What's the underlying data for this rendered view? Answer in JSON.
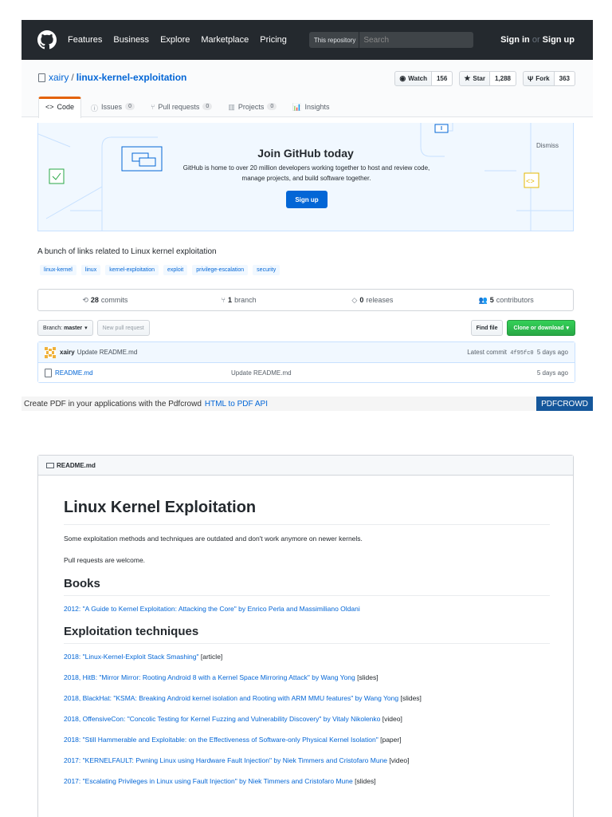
{
  "header": {
    "nav": [
      "Features",
      "Business",
      "Explore",
      "Marketplace",
      "Pricing"
    ],
    "search_scope": "This repository",
    "search_placeholder": "Search",
    "sign_in": "Sign in",
    "or": "or",
    "sign_up": "Sign up"
  },
  "repo": {
    "owner": "xairy",
    "name": "linux-kernel-exploitation",
    "watch_label": "Watch",
    "watch_count": "156",
    "star_label": "Star",
    "star_count": "1,288",
    "fork_label": "Fork",
    "fork_count": "363"
  },
  "tabs": [
    {
      "label": "Code",
      "counter": ""
    },
    {
      "label": "Issues",
      "counter": "0"
    },
    {
      "label": "Pull requests",
      "counter": "0"
    },
    {
      "label": "Projects",
      "counter": "0"
    },
    {
      "label": "Insights",
      "counter": ""
    }
  ],
  "banner": {
    "title": "Join GitHub today",
    "lead": "GitHub is home to over 20 million developers working together to host and review code, manage projects, and build software together.",
    "signup": "Sign up",
    "dismiss": "Dismiss"
  },
  "description": "A bunch of links related to Linux kernel exploitation",
  "topics": [
    "linux-kernel",
    "linux",
    "kernel-exploitation",
    "exploit",
    "privilege-escalation",
    "security"
  ],
  "summary": {
    "commits_num": "28",
    "commits_label": "commits",
    "branch_num": "1",
    "branch_label": "branch",
    "releases_num": "0",
    "releases_label": "releases",
    "contributors_num": "5",
    "contributors_label": "contributors"
  },
  "filenav": {
    "branch_label": "Branch:",
    "branch_name": "master",
    "new_pr": "New pull request",
    "find_file": "Find file",
    "clone": "Clone or download"
  },
  "commit": {
    "author": "xairy",
    "message": "Update README.md",
    "latest_label": "Latest commit",
    "sha": "4f95fc0",
    "age": "5 days ago"
  },
  "files": [
    {
      "name": "README.md",
      "message": "Update README.md",
      "age": "5 days ago"
    }
  ],
  "pdfcrowd": {
    "text": "Create PDF in your applications with the Pdfcrowd",
    "link": "HTML to PDF API",
    "button": "PDFCROWD"
  },
  "readme": {
    "filename": "README.md",
    "title": "Linux Kernel Exploitation",
    "intro": "Some exploitation methods and techniques are outdated and don't work anymore on newer kernels.",
    "pr_note": "Pull requests are welcome.",
    "books_heading": "Books",
    "books": [
      {
        "link": "2012: \"A Guide to Kernel Exploitation: Attacking the Core\" by Enrico Perla and Massimiliano Oldani",
        "tag": ""
      }
    ],
    "techniques_heading": "Exploitation techniques",
    "techniques": [
      {
        "link": "2018: \"Linux-Kernel-Exploit Stack Smashing\"",
        "tag": "[article]"
      },
      {
        "link": "2018, HitB: \"Mirror Mirror: Rooting Android 8 with a Kernel Space Mirroring Attack\" by Wang Yong",
        "tag": "[slides]"
      },
      {
        "link": "2018, BlackHat: \"KSMA: Breaking Android kernel isolation and Rooting with ARM MMU features\" by Wang Yong",
        "tag": "[slides]"
      },
      {
        "link": "2018, OffensiveCon: \"Concolic Testing for Kernel Fuzzing and Vulnerability Discovery\" by Vitaly Nikolenko",
        "tag": "[video]"
      },
      {
        "link": "2018: \"Still Hammerable and Exploitable: on the Effectiveness of Software-only Physical Kernel Isolation\"",
        "tag": "[paper]"
      },
      {
        "link": "2017: \"KERNELFAULT: Pwning Linux using Hardware Fault Injection\" by Niek Timmers and Cristofaro Mune",
        "tag": "[video]"
      },
      {
        "link": "2017: \"Escalating Privileges in Linux using Fault Injection\" by Niek Timmers and Cristofaro Mune",
        "tag": "[slides]"
      }
    ]
  }
}
